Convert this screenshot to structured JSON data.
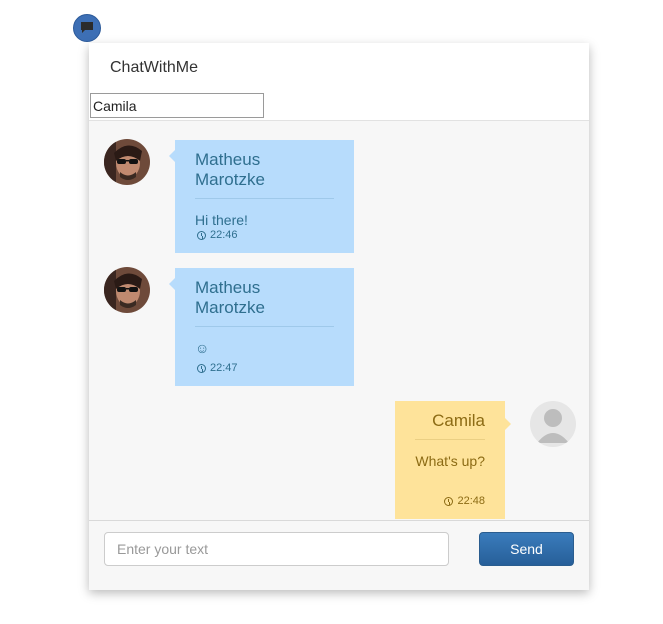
{
  "launcher": {
    "icon": "chat-bubble-icon",
    "color": "#3d6fb5"
  },
  "header": {
    "title": "ChatWithMe",
    "name_value": "Camila"
  },
  "messages": [
    {
      "sender": "Matheus Marotzke",
      "text": "Hi there!",
      "time": "22:46",
      "side": "left",
      "avatar": "user-photo"
    },
    {
      "sender": "Matheus Marotzke",
      "text": "☺",
      "time": "22:47",
      "side": "left",
      "avatar": "user-photo"
    },
    {
      "sender": "Camila",
      "text": "What's up?",
      "time": "22:48",
      "side": "right",
      "avatar": "default-user-icon"
    }
  ],
  "footer": {
    "placeholder": "Enter your text",
    "send_label": "Send"
  },
  "colors": {
    "incoming_bubble": "#b7dcfc",
    "outgoing_bubble": "#fee39a",
    "send_button": "#2f6ea8"
  }
}
